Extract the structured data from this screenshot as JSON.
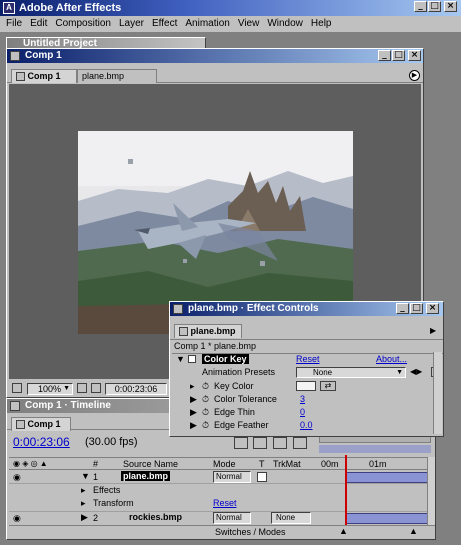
{
  "app": {
    "title": "Adobe After Effects"
  },
  "menu": [
    "File",
    "Edit",
    "Composition",
    "Layer",
    "Effect",
    "Animation",
    "View",
    "Window",
    "Help"
  ],
  "bg_window": {
    "title": "Untitled Project"
  },
  "comp_window": {
    "title": "Comp 1",
    "tabs": [
      "Comp 1",
      "plane.bmp"
    ],
    "zoom": "100%",
    "timecode": "0:00:23:06"
  },
  "timeline": {
    "title": "Comp 1 · Timeline",
    "tab": "Comp 1",
    "timecode": "0:00:23:06",
    "fps": "(30.00 fps)",
    "col_source": "Source Name",
    "col_mode": "Mode",
    "col_t": "T",
    "col_trkmat": "TrkMat",
    "col_hash": "#",
    "ruler_start": "00m",
    "ruler_mid": "01m",
    "layers": [
      {
        "num": "1",
        "name": "plane.bmp",
        "mode": "Normal",
        "trkmat": ""
      },
      {
        "num": "2",
        "name": "rockies.bmp",
        "mode": "Normal",
        "trkmat": "None"
      }
    ],
    "sub_effects": "Effects",
    "sub_transform": "Transform",
    "reset": "Reset",
    "switches_label": "Switches / Modes"
  },
  "effect_controls": {
    "title": "plane.bmp · Effect Controls",
    "tab": "plane.bmp",
    "subtitle": "Comp 1 * plane.bmp",
    "effect_name": "Color Key",
    "reset": "Reset",
    "about": "About...",
    "presets_label": "Animation Presets",
    "presets_value": "None",
    "props": [
      {
        "label": "Key Color",
        "value": ""
      },
      {
        "label": "Color Tolerance",
        "value": "3"
      },
      {
        "label": "Edge Thin",
        "value": "0"
      },
      {
        "label": "Edge Feather",
        "value": "0.0"
      }
    ]
  },
  "colors": {
    "title_active": "#0a1f6a",
    "accent_link": "#0000cc",
    "timeline_bar": "#8a94d4",
    "playhead": "#cc0000"
  }
}
